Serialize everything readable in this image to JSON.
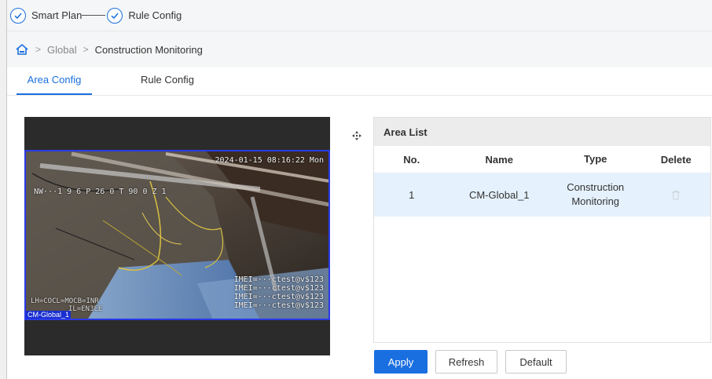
{
  "steps": [
    {
      "label": "Smart Plan"
    },
    {
      "label": "Rule Config"
    }
  ],
  "breadcrumb": {
    "items": [
      "Global",
      "Construction Monitoring"
    ],
    "separator": ">"
  },
  "tabs": [
    {
      "label": "Area Config",
      "active": true
    },
    {
      "label": "Rule Config",
      "active": false
    }
  ],
  "video": {
    "timestamp": "2024-01-15 08:16:22 Mon",
    "osd_left": "NW···1 9 6 P 26 0 T 90 0 Z 1",
    "cred_lines": [
      "IMEI=···ctest@v$123",
      "IMEI=···ctest@v$123",
      "IMEI=···ctest@v$123",
      "IMEI=···ctest@v$123"
    ],
    "bottom_left_lines": [
      "LH=COCL=MOCB=INR",
      "IL=EN3EE"
    ],
    "area_label": "CM-Global_1"
  },
  "area_list": {
    "title": "Area List",
    "columns": [
      "No.",
      "Name",
      "Type",
      "Delete"
    ],
    "rows": [
      {
        "no": "1",
        "name": "CM-Global_1",
        "type_line1": "Construction",
        "type_line2": "Monitoring"
      }
    ]
  },
  "buttons": {
    "apply": "Apply",
    "refresh": "Refresh",
    "default": "Default"
  },
  "colors": {
    "accent": "#1a6fe0",
    "selected_row": "#e5f1fc",
    "area_outline": "#2a3ae8"
  }
}
